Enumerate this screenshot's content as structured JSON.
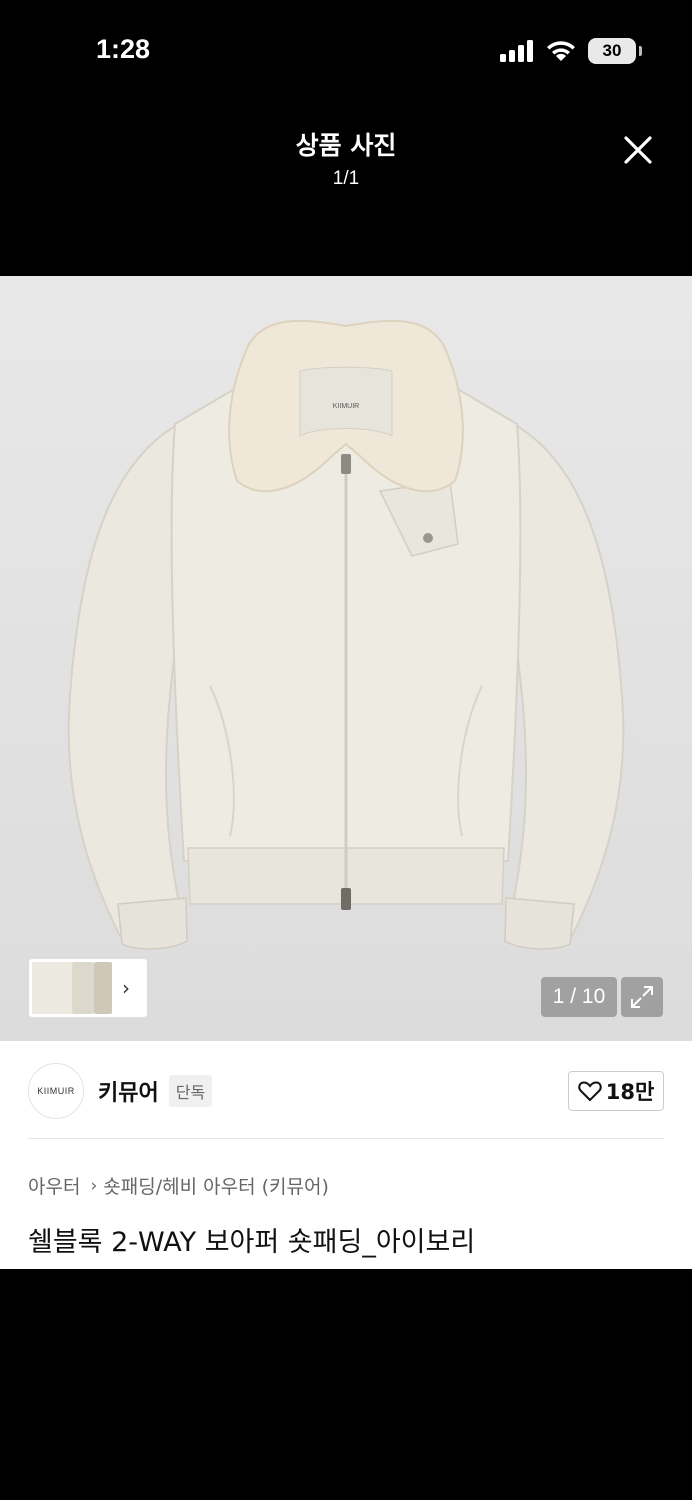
{
  "status_bar": {
    "time": "1:28",
    "battery": "30"
  },
  "viewer": {
    "title": "상품 사진",
    "counter": "1/1"
  },
  "gallery": {
    "counter": "1 / 10",
    "brand_tag_on_jacket": "KIIMUIR"
  },
  "brand": {
    "logo_text": "KIIMUIR",
    "name": "키뮤어",
    "badge": "단독",
    "likes": "18만"
  },
  "breadcrumb": {
    "category": "아우터",
    "sub": "숏패딩/헤비 아우터 (키뮤어)"
  },
  "product": {
    "title": "쉘블록 2-WAY 보아퍼 숏패딩_아이보리"
  },
  "colors": {
    "jacket": "#ece9e1",
    "collar": "#efe7d8",
    "background": "#e2e2e2"
  }
}
